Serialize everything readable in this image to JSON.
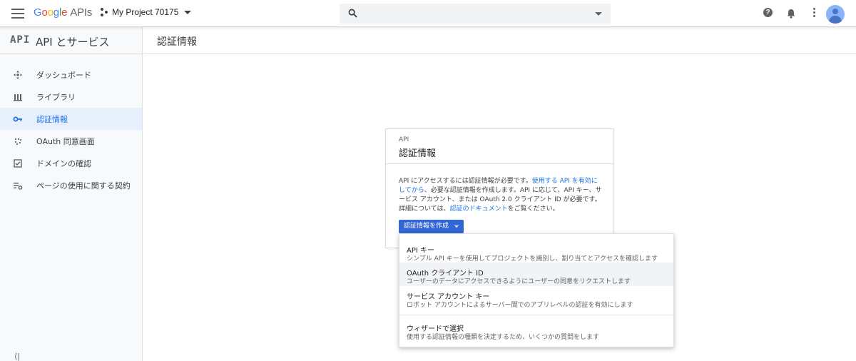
{
  "header": {
    "logo_parts": [
      "G",
      "o",
      "o",
      "g",
      "l",
      "e"
    ],
    "logo_suffix": "APIs",
    "project_name": "My Project 70175",
    "search_placeholder": ""
  },
  "sidebar": {
    "logo": "API",
    "title": "API とサービス",
    "items": [
      {
        "label": "ダッシュボード",
        "icon": "dashboard-icon"
      },
      {
        "label": "ライブラリ",
        "icon": "library-icon"
      },
      {
        "label": "認証情報",
        "icon": "key-icon",
        "active": true
      },
      {
        "label": "OAuth 同意画面",
        "icon": "consent-icon"
      },
      {
        "label": "ドメインの確認",
        "icon": "checkbox-icon"
      },
      {
        "label": "ページの使用に関する契約",
        "icon": "settings-list-icon"
      }
    ],
    "collapse": "⟨|"
  },
  "main": {
    "page_title": "認証情報"
  },
  "card": {
    "eyebrow": "API",
    "title": "認証情報",
    "desc_1": "API にアクセスするには認証情報が必要です。",
    "desc_link1": "使用する API を有効にしてから",
    "desc_2": "、必要な認証情報を作成します。API に応じて、API キー、サービス アカウント、または OAuth 2.0 クライアント ID が必要です。詳細については、",
    "desc_link2": "認証のドキュメント",
    "desc_3": "をご覧ください。",
    "button": "認証情報を作成"
  },
  "dropdown": {
    "items": [
      {
        "title": "API キー",
        "desc": "シンプル API キーを使用してプロジェクトを識別し、割り当てとアクセスを確認します"
      },
      {
        "title": "OAuth クライアント ID",
        "desc": "ユーザーのデータにアクセスできるようにユーザーの同意をリクエストします"
      },
      {
        "title": "サービス アカウント キー",
        "desc": "ロボット アカウントによるサーバー間でのアプリレベルの認証を有効にします"
      },
      {
        "title": "ウィザードで選択",
        "desc": "使用する認証情報の種類を決定するため、いくつかの質問をします"
      }
    ]
  },
  "colors": {
    "accent": "#1a73e8",
    "button": "#3367d6",
    "active_bg": "#e8f0fe"
  }
}
